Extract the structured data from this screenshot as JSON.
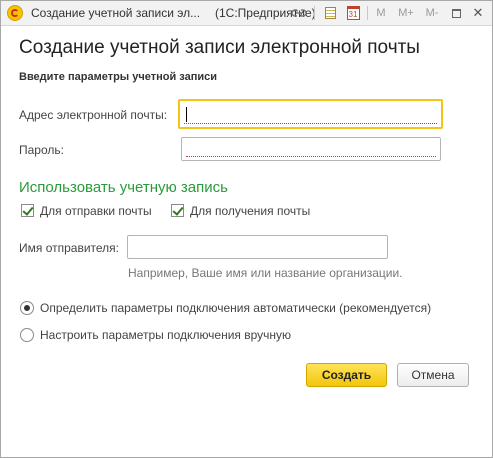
{
  "titlebar": {
    "title": "Создание учетной записи эл...",
    "app": "(1С:Предприятие)",
    "icons": [
      "link-icon",
      "calculator-icon",
      "calendar-icon",
      "memory-m",
      "memory-plus",
      "memory-minus",
      "maximize-icon",
      "close-icon"
    ],
    "calendar_day": "31",
    "m_label": "M",
    "mplus_label": "M+",
    "mminus_label": "M-",
    "close_glyph": "✕"
  },
  "dialog": {
    "heading": "Создание учетной записи электронной почты",
    "subheading": "Введите параметры учетной записи",
    "email": {
      "label": "Адрес электронной почты:",
      "value": "",
      "placeholder": ""
    },
    "password": {
      "label": "Пароль:",
      "value": "",
      "placeholder": ""
    },
    "use_section": {
      "title": "Использовать учетную запись",
      "for_sending": {
        "label": "Для отправки почты",
        "checked": true
      },
      "for_receiving": {
        "label": "Для получения почты",
        "checked": true
      }
    },
    "sender": {
      "label": "Имя отправителя:",
      "value": "",
      "hint": "Например, Ваше имя или название организации."
    },
    "connection": {
      "selected": "auto",
      "auto_label": "Определить параметры подключения автоматически (рекомендуется)",
      "manual_label": "Настроить параметры подключения вручную"
    },
    "buttons": {
      "create": "Создать",
      "cancel": "Отмена"
    }
  },
  "colors": {
    "accent_yellow": "#f3c60a",
    "focus_border": "#f0c419",
    "section_green": "#2a9b3a",
    "required_underline": "#c0392b"
  }
}
